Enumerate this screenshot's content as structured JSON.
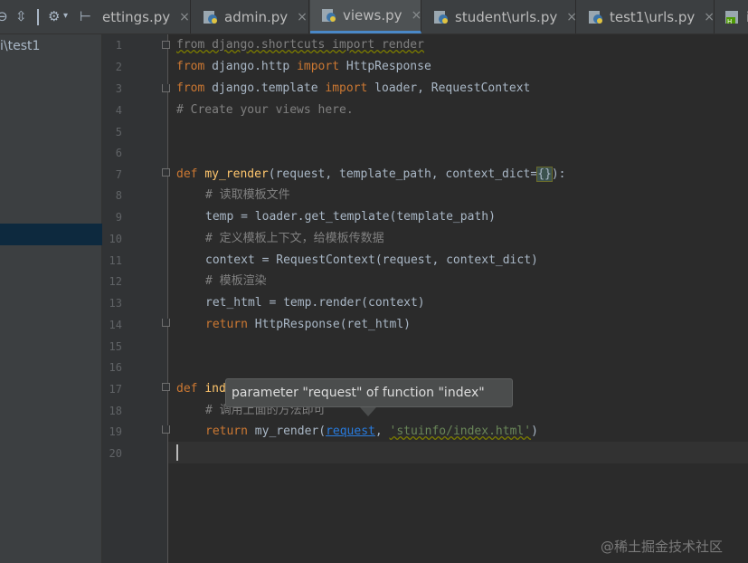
{
  "sidebar": {
    "toolbar_icons": [
      "target-icon",
      "collapse-icon",
      "gear-icon",
      "hide-panel-icon"
    ],
    "tree_item": "i\\test1"
  },
  "tabs": [
    {
      "label": "ettings.py",
      "active": false
    },
    {
      "label": "admin.py",
      "active": false
    },
    {
      "label": "views.py",
      "active": true
    },
    {
      "label": "student\\urls.py",
      "active": false
    },
    {
      "label": "test1\\urls.py",
      "active": false
    },
    {
      "label": "i",
      "active": false
    }
  ],
  "tab_close": "×",
  "editor": {
    "line_numbers": [
      "1",
      "2",
      "3",
      "4",
      "5",
      "6",
      "7",
      "8",
      "9",
      "10",
      "11",
      "12",
      "13",
      "14",
      "15",
      "16",
      "17",
      "18",
      "19",
      "20"
    ],
    "lines": {
      "l1": "from django.shortcuts import render",
      "l2_a": "from",
      "l2_b": " django.http ",
      "l2_c": "import",
      "l2_d": " HttpResponse",
      "l3_a": "from",
      "l3_b": " django.template ",
      "l3_c": "import",
      "l3_d": " loader, RequestContext",
      "l4": "# Create your views here.",
      "l7_a": "def ",
      "l7_b": "my_render",
      "l7_c": "(request, template_path, context_dict=",
      "l7_d": "{}",
      "l7_e": "):",
      "l8": "# 读取模板文件",
      "l9": "temp = loader.get_template(template_path)",
      "l10": "# 定义模板上下文，给模板传数据",
      "l11": "context = RequestContext(request, context_dict)",
      "l12": "# 模板渲染",
      "l13": "ret_html = temp.render(context)",
      "l14_a": "return",
      "l14_b": " HttpResponse(ret_html)",
      "l17_a": "def ",
      "l17_b": "ind",
      "l18": "# 调用上面的方法即可",
      "l19_a": "return",
      "l19_b": " my_render(",
      "l19_c": "request",
      "l19_d": ", ",
      "l19_e": "'stuinfo/index.html'",
      "l19_f": ")"
    },
    "tooltip": "parameter \"request\" of function \"index\""
  },
  "watermark": "@稀土掘金技术社区",
  "colors": {
    "background": "#2b2b2b",
    "keyword": "#cc7832",
    "comment": "#808080",
    "string": "#6a8759",
    "function": "#ffc66d",
    "link": "#287bde",
    "active_tab_underline": "#4a88c7"
  }
}
